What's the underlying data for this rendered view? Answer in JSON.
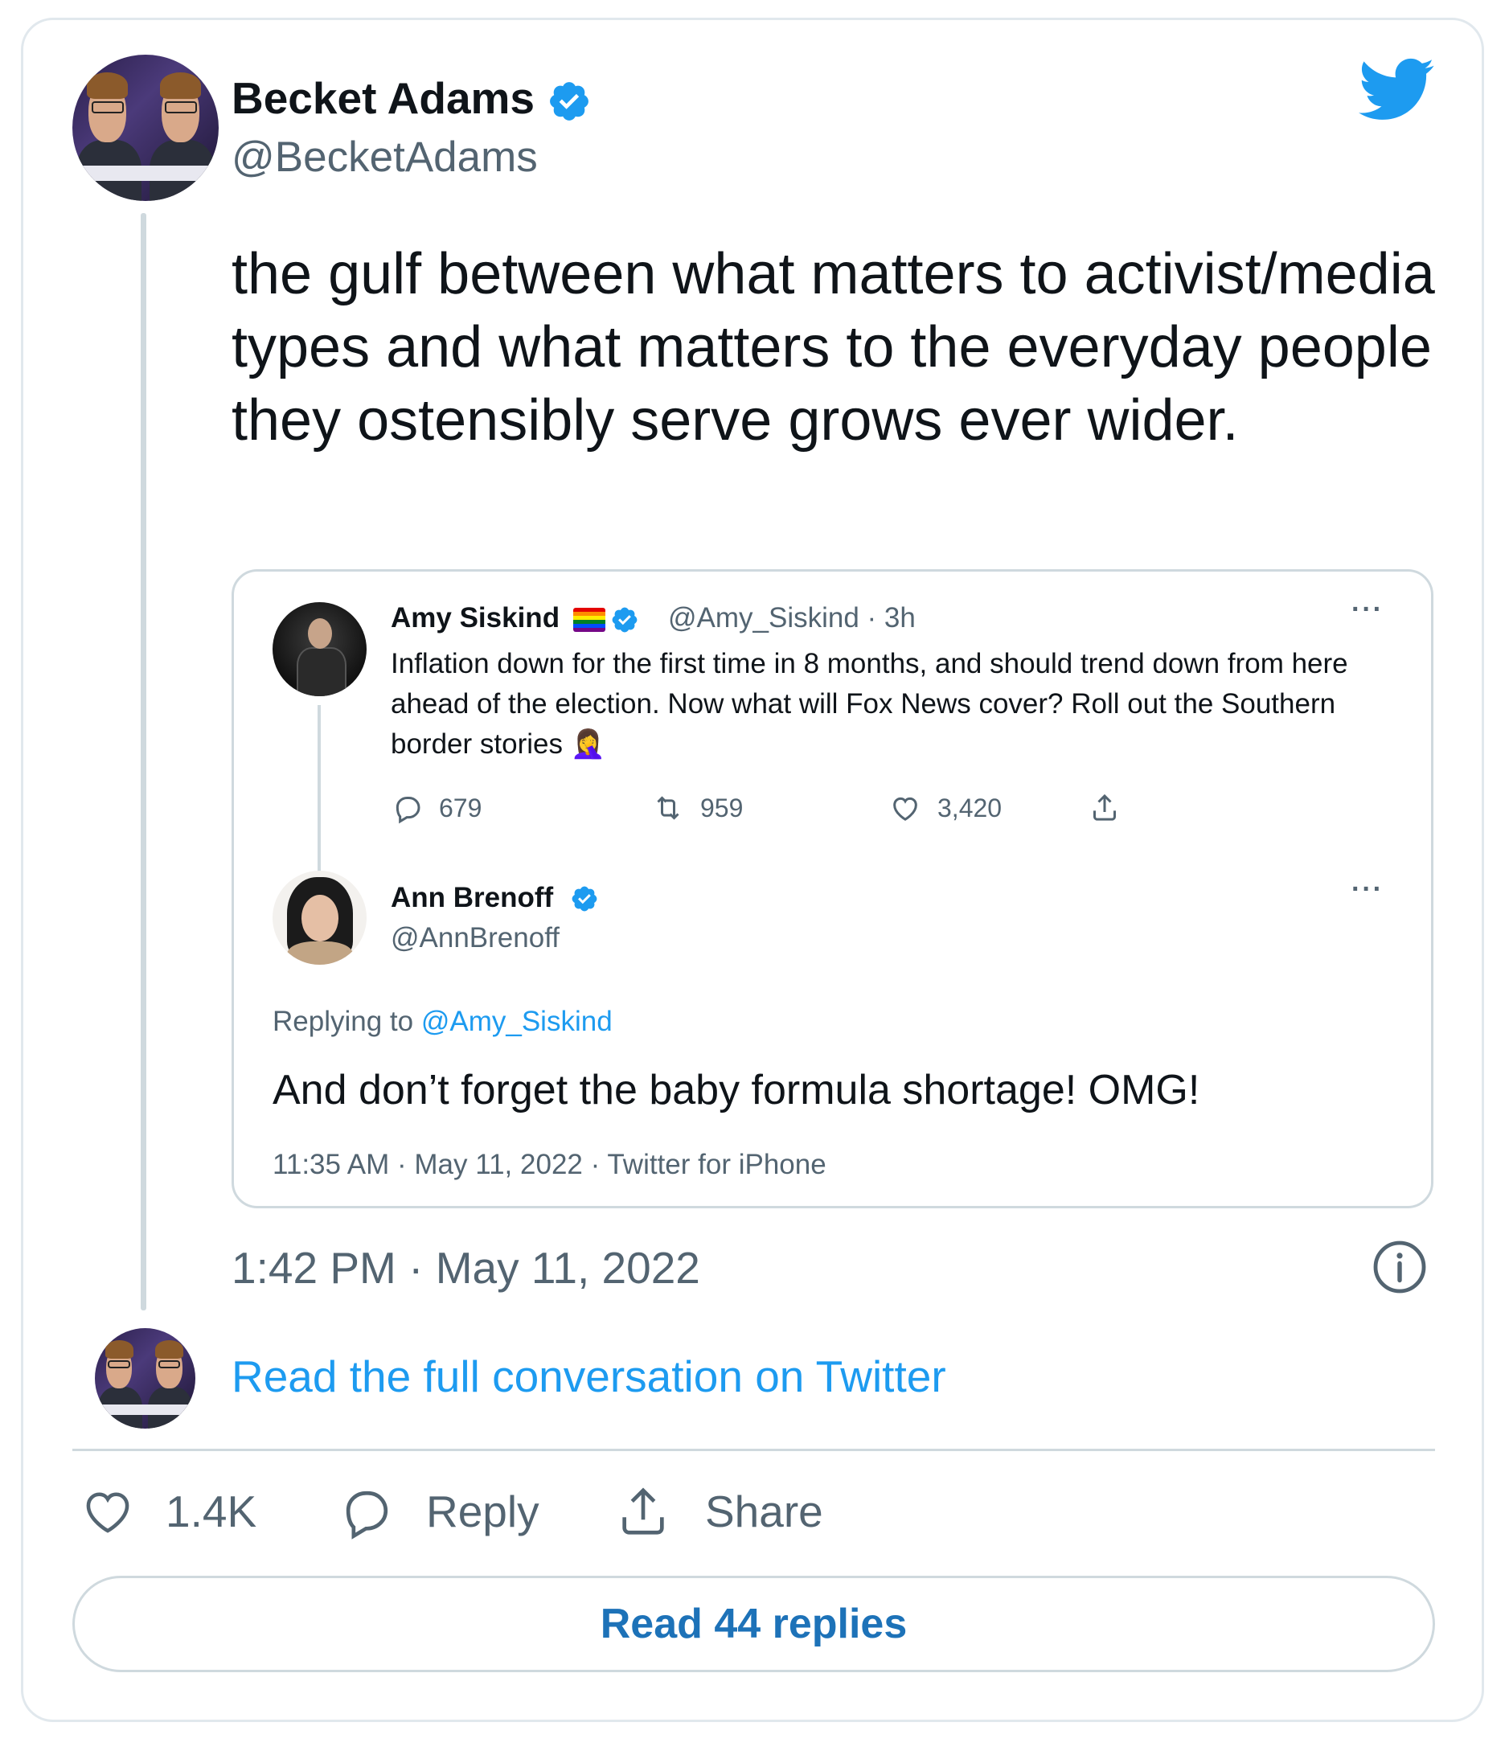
{
  "tweet": {
    "author_name": "Becket Adams",
    "author_handle": "@BecketAdams",
    "text": "the gulf between what matters to activist/media types and what matters to the everyday people they ostensibly serve grows ever wider.",
    "timestamp": "1:42 PM · May 11, 2022",
    "read_full_label": "Read the full conversation on Twitter",
    "likes": "1.4K",
    "reply_label": "Reply",
    "share_label": "Share",
    "read_replies_label": "Read 44 replies"
  },
  "quoted": {
    "first": {
      "name": "Amy Siskind",
      "meta": "@Amy_Siskind · 3h",
      "text": "Inflation down for the first time in 8 months, and should trend down from here ahead of the election. Now what will Fox News cover? Roll out the Southern border stories 🤦‍♀️",
      "replies": "679",
      "retweets": "959",
      "likes": "3,420"
    },
    "second": {
      "name": "Ann Brenoff",
      "handle": "@AnnBrenoff",
      "replying_prefix": "Replying to",
      "replying_to": "@Amy_Siskind",
      "text": "And don’t forget the baby formula shortage! OMG!",
      "time": "11:35 AM · May 11, 2022 · Twitter for iPhone"
    }
  },
  "colors": {
    "accent": "#1d9bf0",
    "secondary_text": "#536471",
    "border": "#cfd9de"
  },
  "icons": [
    "twitter-bird-icon",
    "verified-badge-icon",
    "more-icon",
    "reply-icon",
    "retweet-icon",
    "like-icon",
    "share-icon",
    "info-icon",
    "heart-icon"
  ]
}
